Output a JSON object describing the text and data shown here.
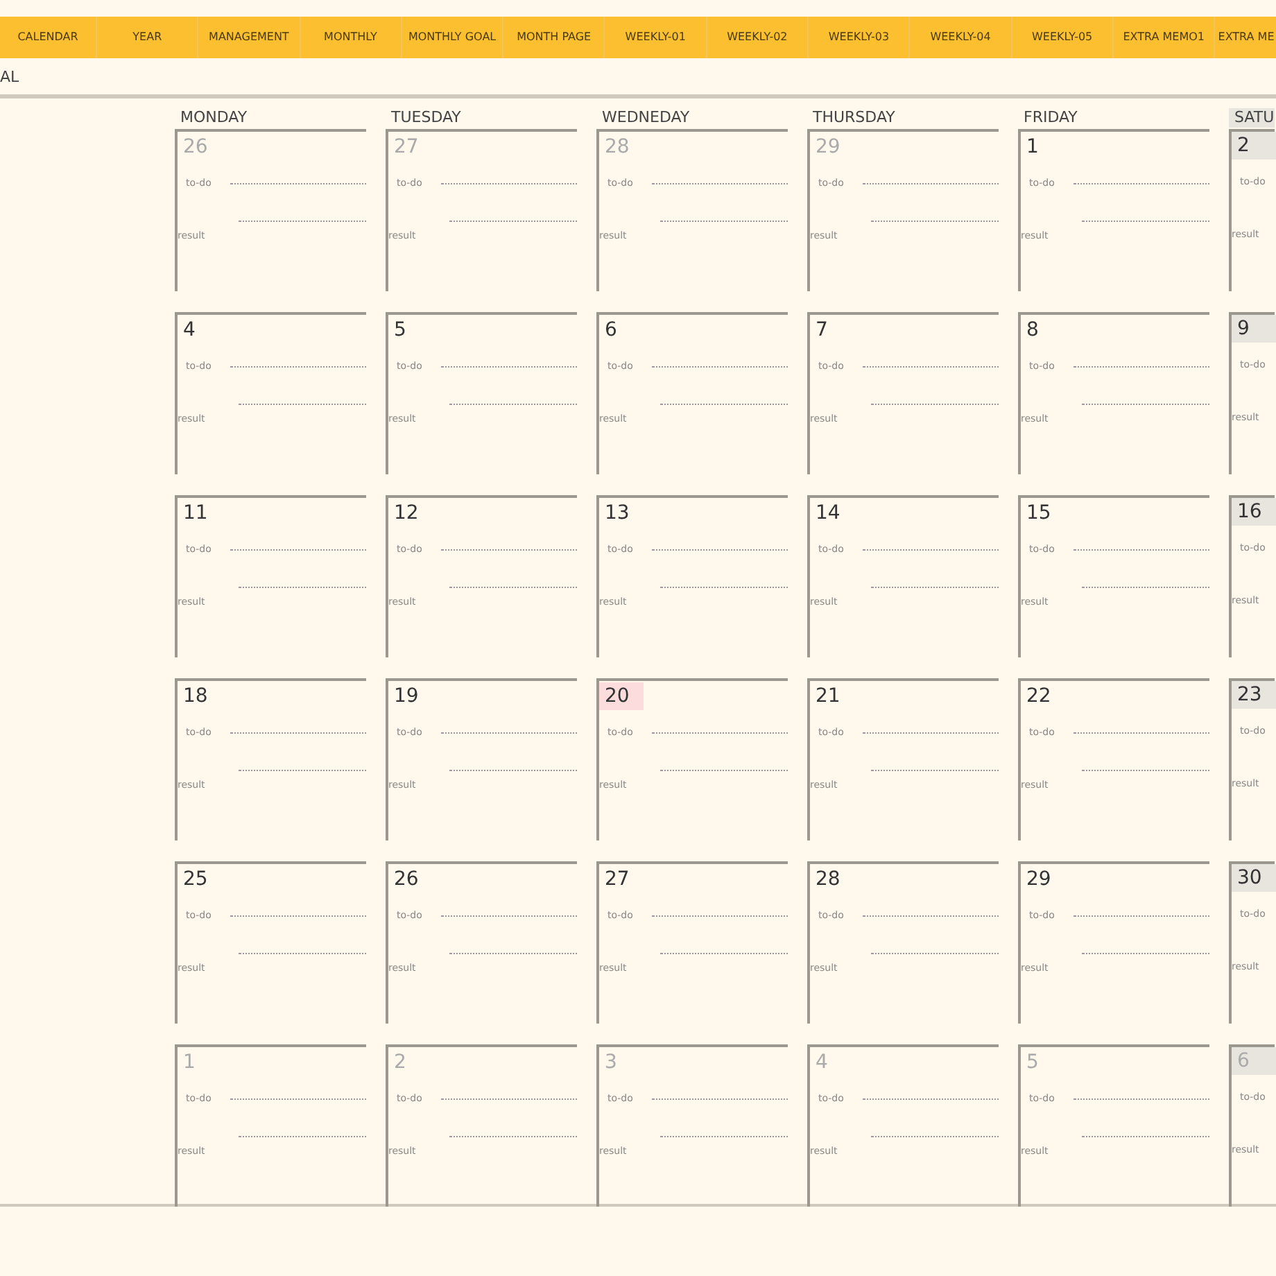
{
  "tabs": [
    "CALENDAR",
    "YEAR",
    "MANAGEMENT",
    "MONTHLY",
    "MONTHLY GOAL",
    "MONTH PAGE",
    "WEEKLY-01",
    "WEEKLY-02",
    "WEEKLY-03",
    "WEEKLY-04",
    "WEEKLY-05",
    "EXTRA MEMO1",
    "EXTRA ME"
  ],
  "title_fragment": "AL",
  "days": [
    {
      "label": "MONDAY",
      "weekend": false
    },
    {
      "label": "TUESDAY",
      "weekend": false
    },
    {
      "label": "WEDNEDAY",
      "weekend": false
    },
    {
      "label": "THURSDAY",
      "weekend": false
    },
    {
      "label": "FRIDAY",
      "weekend": false
    },
    {
      "label": "SATU",
      "weekend": true
    }
  ],
  "weeks": [
    {
      "cells": [
        {
          "date": "26",
          "other_month": true,
          "today": false,
          "todo_label": "to-do",
          "result_label": "result"
        },
        {
          "date": "27",
          "other_month": true,
          "today": false,
          "todo_label": "to-do",
          "result_label": "result"
        },
        {
          "date": "28",
          "other_month": true,
          "today": false,
          "todo_label": "to-do",
          "result_label": "result"
        },
        {
          "date": "29",
          "other_month": true,
          "today": false,
          "todo_label": "to-do",
          "result_label": "result"
        },
        {
          "date": "1",
          "other_month": false,
          "today": false,
          "todo_label": "to-do",
          "result_label": "result"
        },
        {
          "date": "2",
          "other_month": false,
          "today": false,
          "todo_label": "to-do",
          "result_label": "result"
        }
      ]
    },
    {
      "cells": [
        {
          "date": "4",
          "other_month": false,
          "today": false,
          "todo_label": "to-do",
          "result_label": "result"
        },
        {
          "date": "5",
          "other_month": false,
          "today": false,
          "todo_label": "to-do",
          "result_label": "result"
        },
        {
          "date": "6",
          "other_month": false,
          "today": false,
          "todo_label": "to-do",
          "result_label": "result"
        },
        {
          "date": "7",
          "other_month": false,
          "today": false,
          "todo_label": "to-do",
          "result_label": "result"
        },
        {
          "date": "8",
          "other_month": false,
          "today": false,
          "todo_label": "to-do",
          "result_label": "result"
        },
        {
          "date": "9",
          "other_month": false,
          "today": false,
          "todo_label": "to-do",
          "result_label": "result"
        }
      ]
    },
    {
      "cells": [
        {
          "date": "11",
          "other_month": false,
          "today": false,
          "todo_label": "to-do",
          "result_label": "result"
        },
        {
          "date": "12",
          "other_month": false,
          "today": false,
          "todo_label": "to-do",
          "result_label": "result"
        },
        {
          "date": "13",
          "other_month": false,
          "today": false,
          "todo_label": "to-do",
          "result_label": "result"
        },
        {
          "date": "14",
          "other_month": false,
          "today": false,
          "todo_label": "to-do",
          "result_label": "result"
        },
        {
          "date": "15",
          "other_month": false,
          "today": false,
          "todo_label": "to-do",
          "result_label": "result"
        },
        {
          "date": "16",
          "other_month": false,
          "today": false,
          "todo_label": "to-do",
          "result_label": "result"
        }
      ]
    },
    {
      "cells": [
        {
          "date": "18",
          "other_month": false,
          "today": false,
          "todo_label": "to-do",
          "result_label": "result"
        },
        {
          "date": "19",
          "other_month": false,
          "today": false,
          "todo_label": "to-do",
          "result_label": "result"
        },
        {
          "date": "20",
          "other_month": false,
          "today": true,
          "todo_label": "to-do",
          "result_label": "result"
        },
        {
          "date": "21",
          "other_month": false,
          "today": false,
          "todo_label": "to-do",
          "result_label": "result"
        },
        {
          "date": "22",
          "other_month": false,
          "today": false,
          "todo_label": "to-do",
          "result_label": "result"
        },
        {
          "date": "23",
          "other_month": false,
          "today": false,
          "todo_label": "to-do",
          "result_label": "result"
        }
      ]
    },
    {
      "cells": [
        {
          "date": "25",
          "other_month": false,
          "today": false,
          "todo_label": "to-do",
          "result_label": "result"
        },
        {
          "date": "26",
          "other_month": false,
          "today": false,
          "todo_label": "to-do",
          "result_label": "result"
        },
        {
          "date": "27",
          "other_month": false,
          "today": false,
          "todo_label": "to-do",
          "result_label": "result"
        },
        {
          "date": "28",
          "other_month": false,
          "today": false,
          "todo_label": "to-do",
          "result_label": "result"
        },
        {
          "date": "29",
          "other_month": false,
          "today": false,
          "todo_label": "to-do",
          "result_label": "result"
        },
        {
          "date": "30",
          "other_month": false,
          "today": false,
          "todo_label": "to-do",
          "result_label": "result"
        }
      ]
    },
    {
      "cells": [
        {
          "date": "1",
          "other_month": true,
          "today": false,
          "todo_label": "to-do",
          "result_label": "result"
        },
        {
          "date": "2",
          "other_month": true,
          "today": false,
          "todo_label": "to-do",
          "result_label": "result"
        },
        {
          "date": "3",
          "other_month": true,
          "today": false,
          "todo_label": "to-do",
          "result_label": "result"
        },
        {
          "date": "4",
          "other_month": true,
          "today": false,
          "todo_label": "to-do",
          "result_label": "result"
        },
        {
          "date": "5",
          "other_month": true,
          "today": false,
          "todo_label": "to-do",
          "result_label": "result"
        },
        {
          "date": "6",
          "other_month": true,
          "today": false,
          "todo_label": "to-do",
          "result_label": "result"
        }
      ]
    }
  ]
}
